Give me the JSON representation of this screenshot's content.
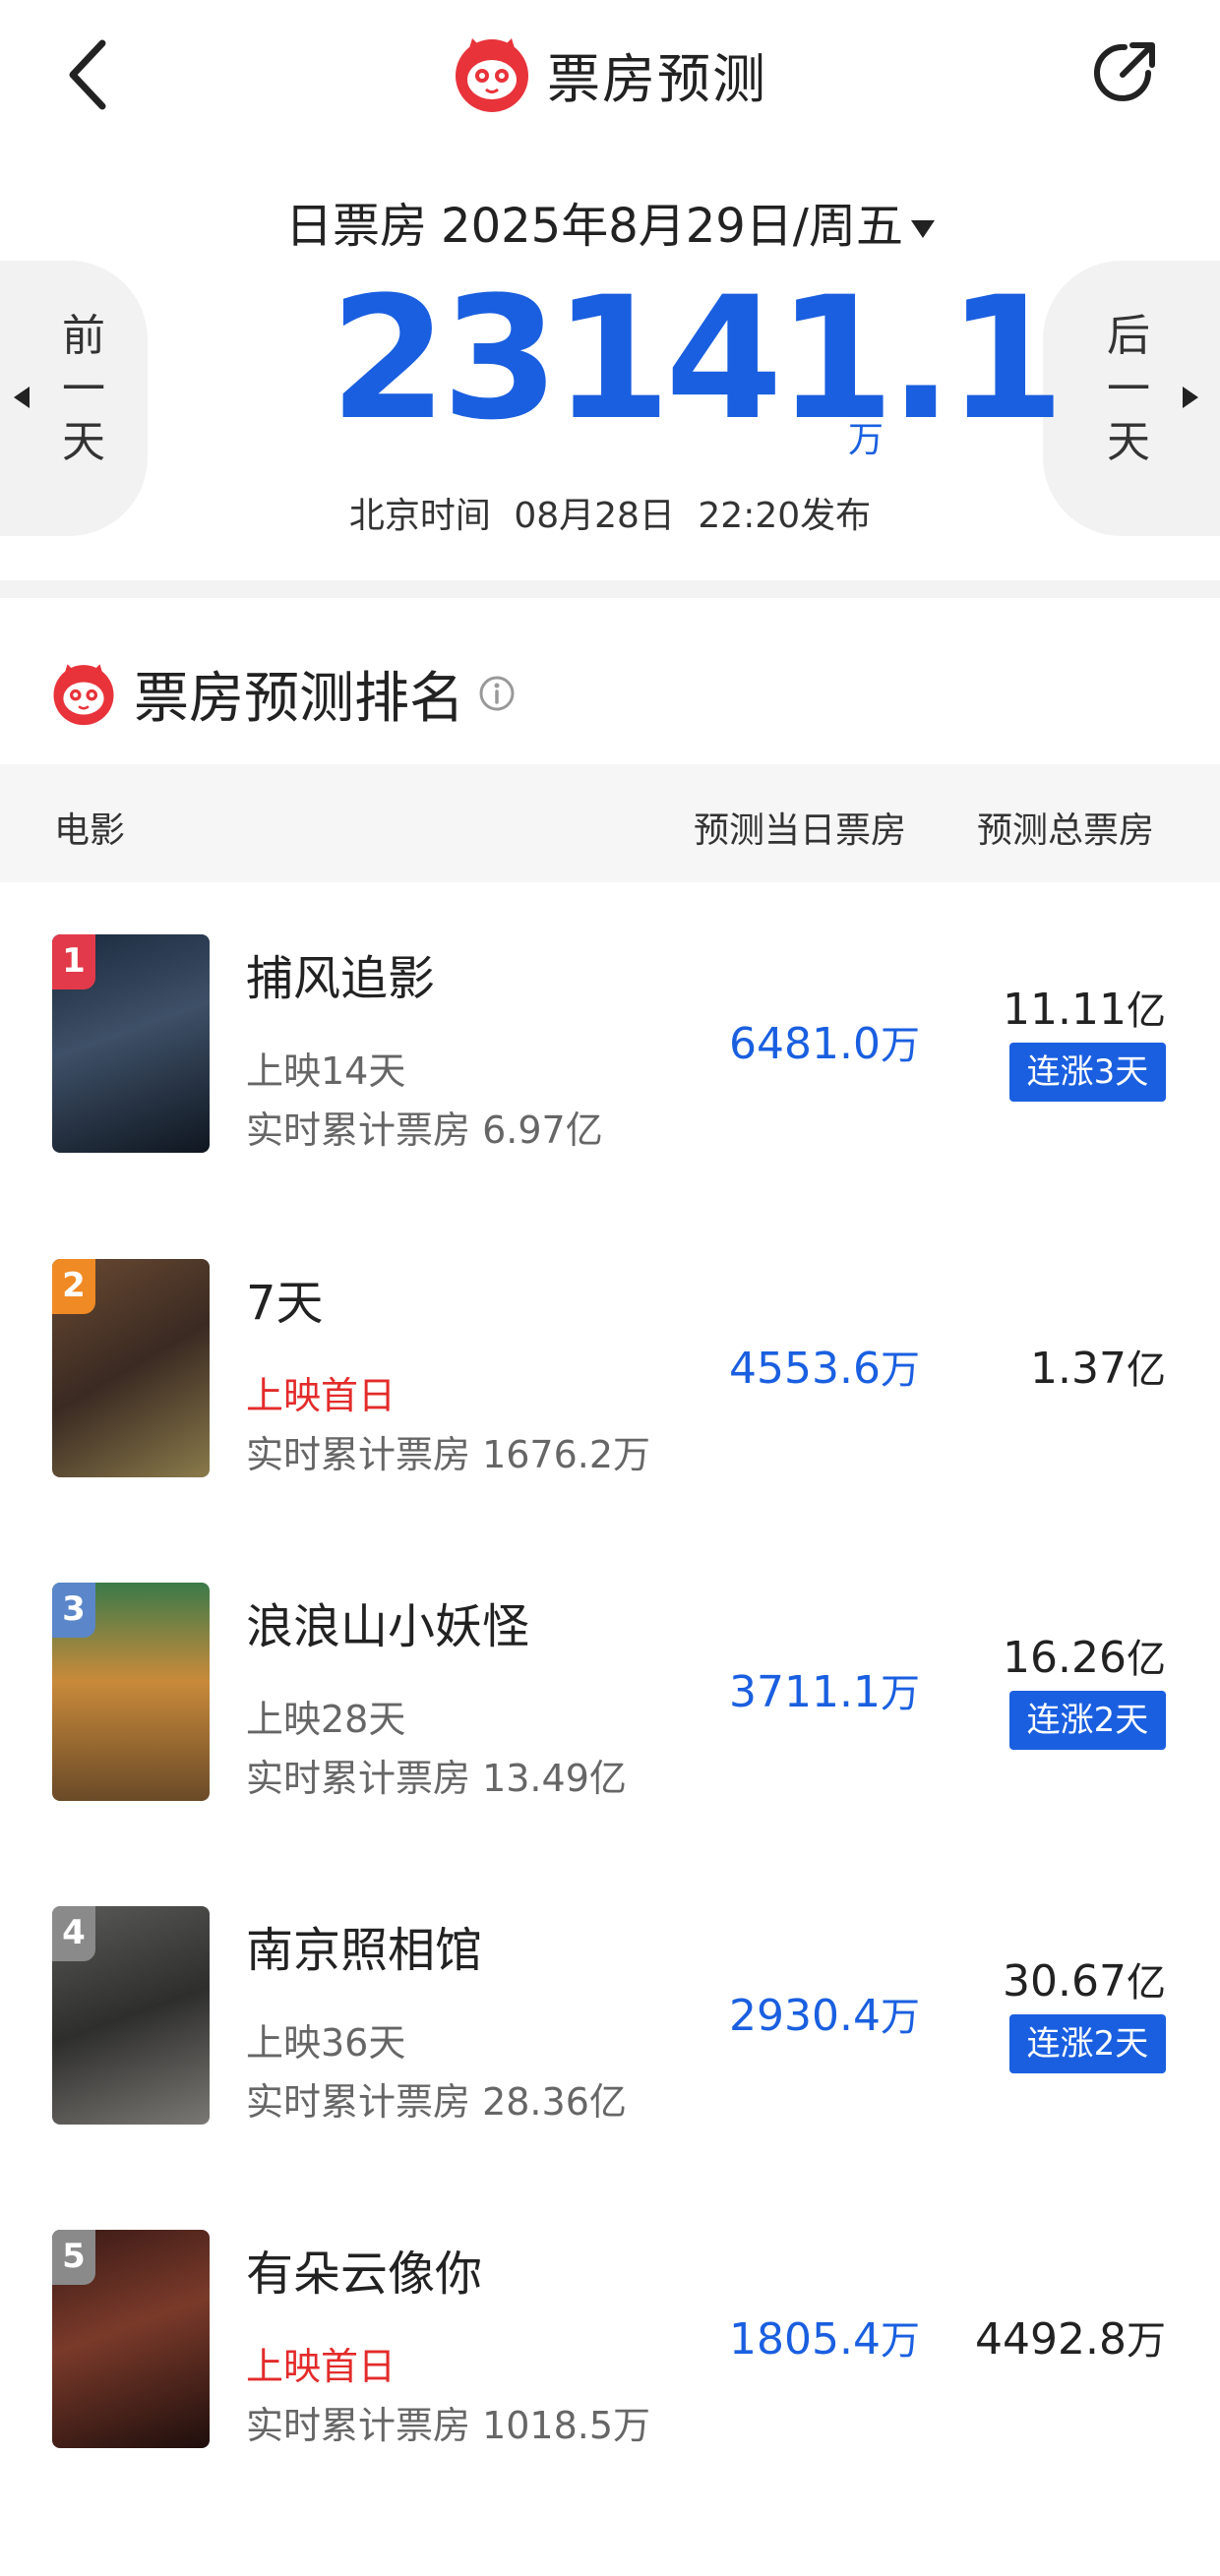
{
  "header": {
    "title": "票房预测"
  },
  "date_bar": {
    "label": "日票房",
    "date": "2025年8月29日/周五"
  },
  "nav": {
    "prev": "前一天",
    "next": "后一天"
  },
  "summary": {
    "value": "23141.1",
    "unit": "万",
    "publish_label": "北京时间",
    "publish_date": "08月28日",
    "publish_time": "22:20发布"
  },
  "section": {
    "title": "票房预测排名"
  },
  "table_header": {
    "movie": "电影",
    "daily": "预测当日票房",
    "total": "预测总票房"
  },
  "colors": {
    "accent": "#1a5fe0",
    "brand_red": "#e8333a",
    "highlight_red": "#e32b2b"
  },
  "movies": [
    {
      "rank": "1",
      "title": "捕风追影",
      "status": "上映14天",
      "cumulative": "实时累计票房 6.97亿",
      "daily_value": "6481.0",
      "daily_unit": "万",
      "total_value": "11.11",
      "total_unit": "亿",
      "badge": "连涨3天",
      "rank_color": "#e23a4a"
    },
    {
      "rank": "2",
      "title": "7天",
      "status": "上映首日",
      "cumulative": "实时累计票房 1676.2万",
      "daily_value": "4553.6",
      "daily_unit": "万",
      "total_value": "1.37",
      "total_unit": "亿",
      "badge": "",
      "rank_color": "#f08a24"
    },
    {
      "rank": "3",
      "title": "浪浪山小妖怪",
      "status": "上映28天",
      "cumulative": "实时累计票房 13.49亿",
      "daily_value": "3711.1",
      "daily_unit": "万",
      "total_value": "16.26",
      "total_unit": "亿",
      "badge": "连涨2天",
      "rank_color": "#5b86c9"
    },
    {
      "rank": "4",
      "title": "南京照相馆",
      "status": "上映36天",
      "cumulative": "实时累计票房 28.36亿",
      "daily_value": "2930.4",
      "daily_unit": "万",
      "total_value": "30.67",
      "total_unit": "亿",
      "badge": "连涨2天",
      "rank_color": "#8a8a8a"
    },
    {
      "rank": "5",
      "title": "有朵云像你",
      "status": "上映首日",
      "cumulative": "实时累计票房 1018.5万",
      "daily_value": "1805.4",
      "daily_unit": "万",
      "total_value": "4492.8",
      "total_unit": "万",
      "badge": "",
      "rank_color": "#8a8a8a"
    }
  ]
}
